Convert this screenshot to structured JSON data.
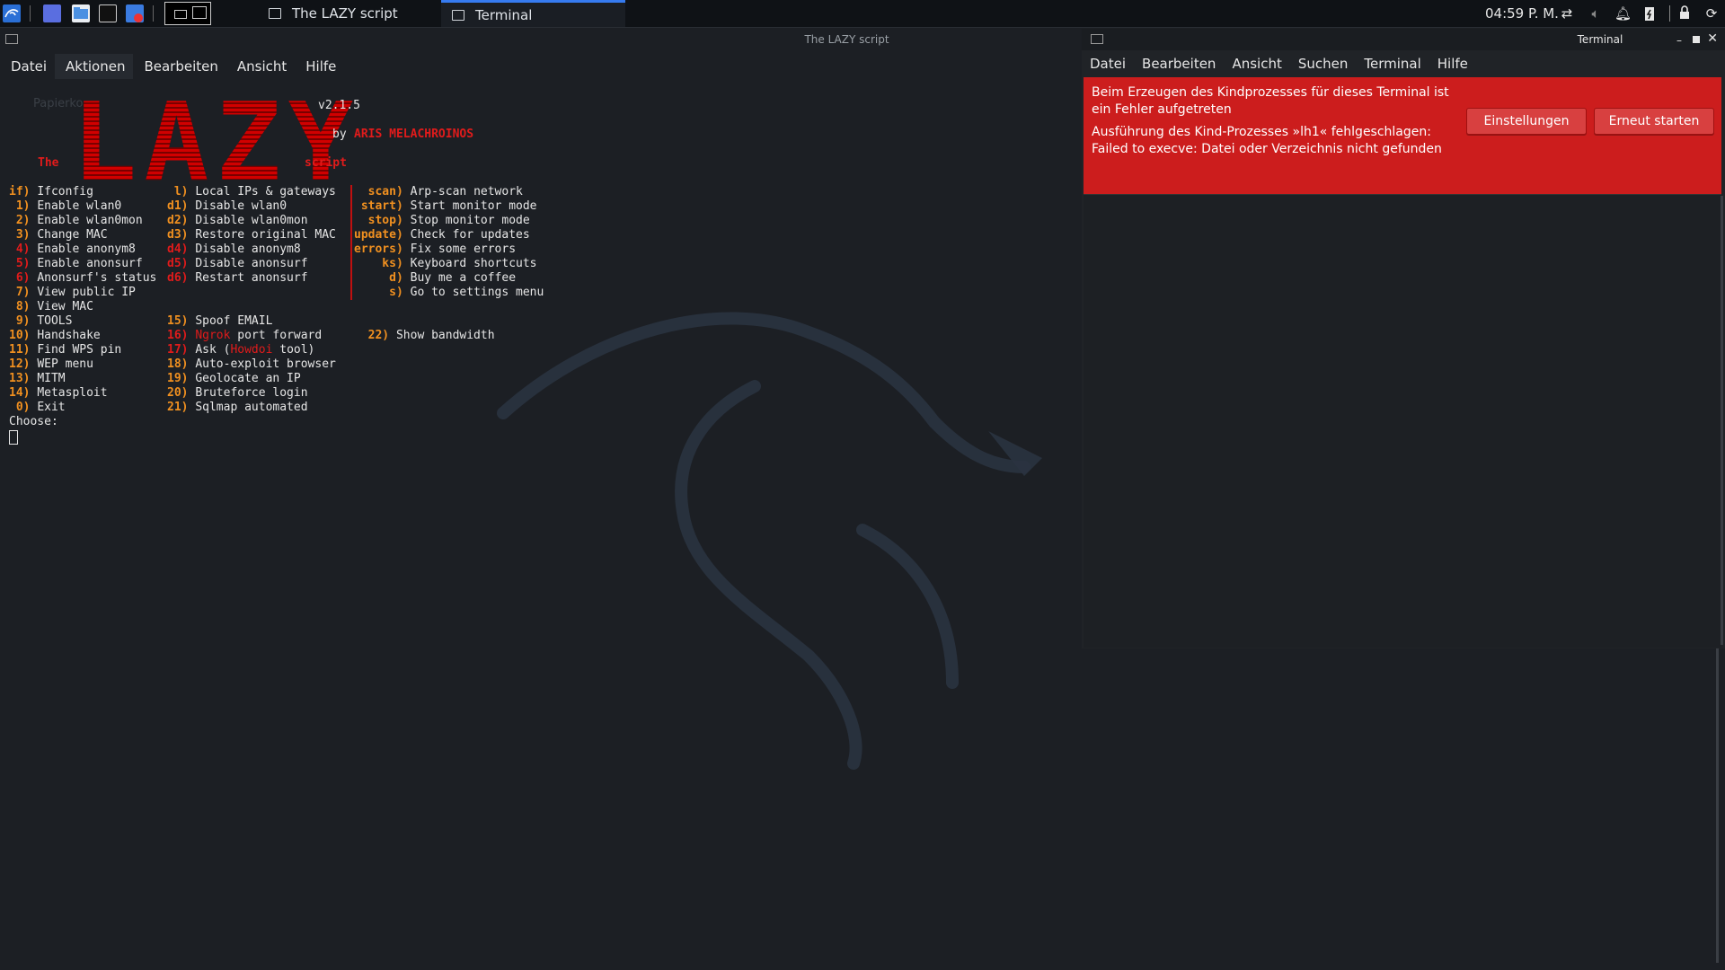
{
  "taskbar": {
    "tasks": [
      {
        "label": "The LAZY script",
        "active": false
      },
      {
        "label": "Terminal",
        "active": true
      }
    ],
    "clock": "04:59 P. M."
  },
  "lazy": {
    "title": "The LAZY script",
    "menu": [
      "Datei",
      "Aktionen",
      "Bearbeiten",
      "Ansicht",
      "Hilfe"
    ],
    "bg_ghost_text": "Papierko",
    "logo": "LAZY",
    "version": "v2.1.5",
    "by": "by",
    "author": "ARIS MELACHROINOS",
    "the": "The",
    "script": "script",
    "col1": [
      {
        "key": "if)",
        "key_color": "orange",
        "label": "Ifconfig"
      },
      {
        "key": " 1)",
        "key_color": "orange",
        "label": "Enable wlan0"
      },
      {
        "key": " 2)",
        "key_color": "orange",
        "label": "Enable wlan0mon"
      },
      {
        "key": " 3)",
        "key_color": "orange",
        "label": "Change MAC"
      },
      {
        "key": " 4)",
        "key_color": "red",
        "label": "Enable anonym8"
      },
      {
        "key": " 5)",
        "key_color": "red",
        "label": "Enable anonsurf"
      },
      {
        "key": " 6)",
        "key_color": "red",
        "label": "Anonsurf's status"
      },
      {
        "key": " 7)",
        "key_color": "orange",
        "label": "View public IP"
      },
      {
        "key": " 8)",
        "key_color": "orange",
        "label": "View MAC"
      },
      {
        "key": " 9)",
        "key_color": "orange",
        "label": "TOOLS"
      },
      {
        "key": "10)",
        "key_color": "orange",
        "label": "Handshake"
      },
      {
        "key": "11)",
        "key_color": "orange",
        "label": "Find WPS pin"
      },
      {
        "key": "12)",
        "key_color": "orange",
        "label": "WEP menu"
      },
      {
        "key": "13)",
        "key_color": "orange",
        "label": "MITM"
      },
      {
        "key": "14)",
        "key_color": "orange",
        "label": "Metasploit"
      },
      {
        "key": " 0)",
        "key_color": "orange",
        "label": "Exit"
      }
    ],
    "col2": [
      {
        "key": " l)",
        "key_color": "orange",
        "label": "Local IPs & gateways"
      },
      {
        "key": "d1)",
        "key_color": "orange",
        "label": "Disable wlan0"
      },
      {
        "key": "d2)",
        "key_color": "orange",
        "label": "Disable wlan0mon"
      },
      {
        "key": "d3)",
        "key_color": "orange",
        "label": "Restore original MAC"
      },
      {
        "key": "d4)",
        "key_color": "red",
        "label": "Disable anonym8"
      },
      {
        "key": "d5)",
        "key_color": "red",
        "label": "Disable anonsurf"
      },
      {
        "key": "d6)",
        "key_color": "red",
        "label": "Restart anonsurf"
      }
    ],
    "col2b": [
      {
        "key": "15)",
        "key_color": "orange",
        "label": "Spoof EMAIL"
      },
      {
        "key": "16)",
        "key_color": "red",
        "label": "Ngrok",
        "label2": " port forward"
      },
      {
        "key": "17)",
        "key_color": "red",
        "label": "Ask (",
        "label_red": "Howdoi",
        "label3": " tool)"
      },
      {
        "key": "18)",
        "key_color": "orange",
        "label": "Auto-exploit browser"
      },
      {
        "key": "19)",
        "key_color": "orange",
        "label": "Geolocate an IP"
      },
      {
        "key": "20)",
        "key_color": "orange",
        "label": "Bruteforce login"
      },
      {
        "key": "21)",
        "key_color": "orange",
        "label": "Sqlmap automated"
      }
    ],
    "col3": [
      {
        "key": "  scan)",
        "label": "Arp-scan network"
      },
      {
        "key": " start)",
        "label": "Start monitor mode"
      },
      {
        "key": "  stop)",
        "label": "Stop monitor mode"
      },
      {
        "key": "update)",
        "label": "Check for updates"
      },
      {
        "key": "errors)",
        "label": "Fix some errors"
      },
      {
        "key": "    ks)",
        "label": "Keyboard shortcuts"
      },
      {
        "key": "     d)",
        "label": "Buy me a coffee"
      },
      {
        "key": "     s)",
        "label": "Go to settings menu"
      }
    ],
    "bandwidth_key": "22)",
    "bandwidth_label": "Show bandwidth",
    "prompt": "Choose:"
  },
  "terminal": {
    "title": "Terminal",
    "menu": [
      "Datei",
      "Bearbeiten",
      "Ansicht",
      "Suchen",
      "Terminal",
      "Hilfe"
    ],
    "error_line1": "Beim Erzeugen des Kindprozesses für dieses Terminal ist ein Fehler aufgetreten",
    "error_line2": "Ausführung des Kind-Prozesses »lh1« fehlgeschlagen: Failed to execve: Datei oder Verzeichnis nicht gefunden",
    "btn_settings": "Einstellungen",
    "btn_restart": "Erneut starten"
  },
  "colors": {
    "error_bg": "#cc1d1d",
    "accent": "#367bf0",
    "lazy_red": "#e01b1b",
    "lazy_orange": "#f09020"
  }
}
